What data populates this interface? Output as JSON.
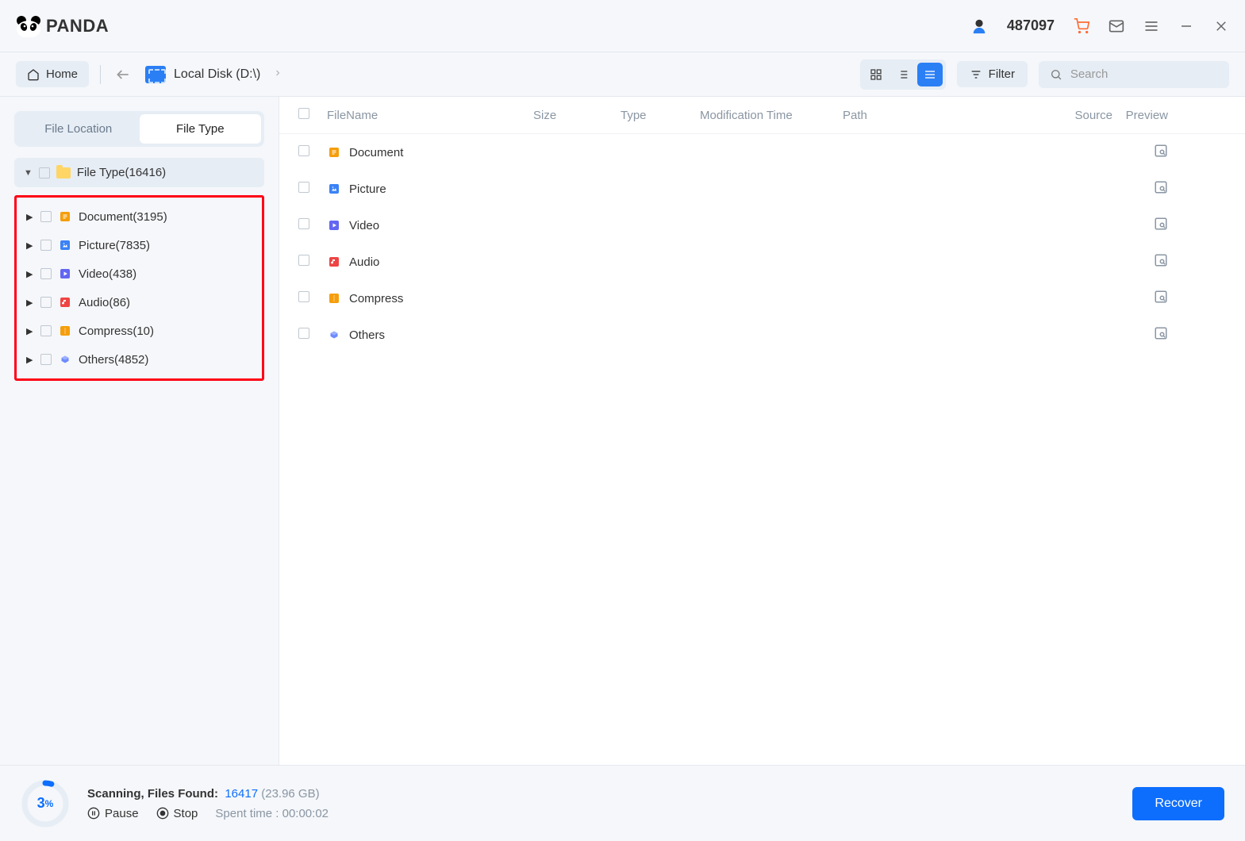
{
  "app_name": "PANDA",
  "user_id": "487097",
  "toolbar": {
    "home_label": "Home",
    "breadcrumb": "Local Disk (D:\\)",
    "filter_label": "Filter",
    "search_placeholder": "Search"
  },
  "sidebar": {
    "tabs": [
      {
        "label": "File Location",
        "active": false
      },
      {
        "label": "File Type",
        "active": true
      }
    ],
    "root": {
      "label": "File Type(16416)"
    },
    "children": [
      {
        "label": "Document(3195)",
        "iconBg": "#f59e0b",
        "svg": "doc"
      },
      {
        "label": "Picture(7835)",
        "iconBg": "#3b82f6",
        "svg": "pic"
      },
      {
        "label": "Video(438)",
        "iconBg": "#6366f1",
        "svg": "vid"
      },
      {
        "label": "Audio(86)",
        "iconBg": "#ef4444",
        "svg": "aud"
      },
      {
        "label": "Compress(10)",
        "iconBg": "#f59e0b",
        "svg": "zip"
      },
      {
        "label": "Others(4852)",
        "iconBg": "transparent",
        "svg": "oth"
      }
    ]
  },
  "columns": {
    "check": "",
    "name": "FileName",
    "size": "Size",
    "type": "Type",
    "mod": "Modification Time",
    "path": "Path",
    "source": "Source",
    "preview": "Preview"
  },
  "rows": [
    {
      "name": "Document",
      "iconBg": "#f59e0b",
      "svg": "doc"
    },
    {
      "name": "Picture",
      "iconBg": "#3b82f6",
      "svg": "pic"
    },
    {
      "name": "Video",
      "iconBg": "#6366f1",
      "svg": "vid"
    },
    {
      "name": "Audio",
      "iconBg": "#ef4444",
      "svg": "aud"
    },
    {
      "name": "Compress",
      "iconBg": "#f59e0b",
      "svg": "zip"
    },
    {
      "name": "Others",
      "iconBg": "transparent",
      "svg": "oth"
    }
  ],
  "footer": {
    "percent": "3",
    "percent_sym": "%",
    "scan_label": "Scanning, Files Found:",
    "count": "16417",
    "size": "(23.96 GB)",
    "pause_label": "Pause",
    "stop_label": "Stop",
    "spent_label": "Spent time : 00:00:02",
    "recover_label": "Recover"
  }
}
